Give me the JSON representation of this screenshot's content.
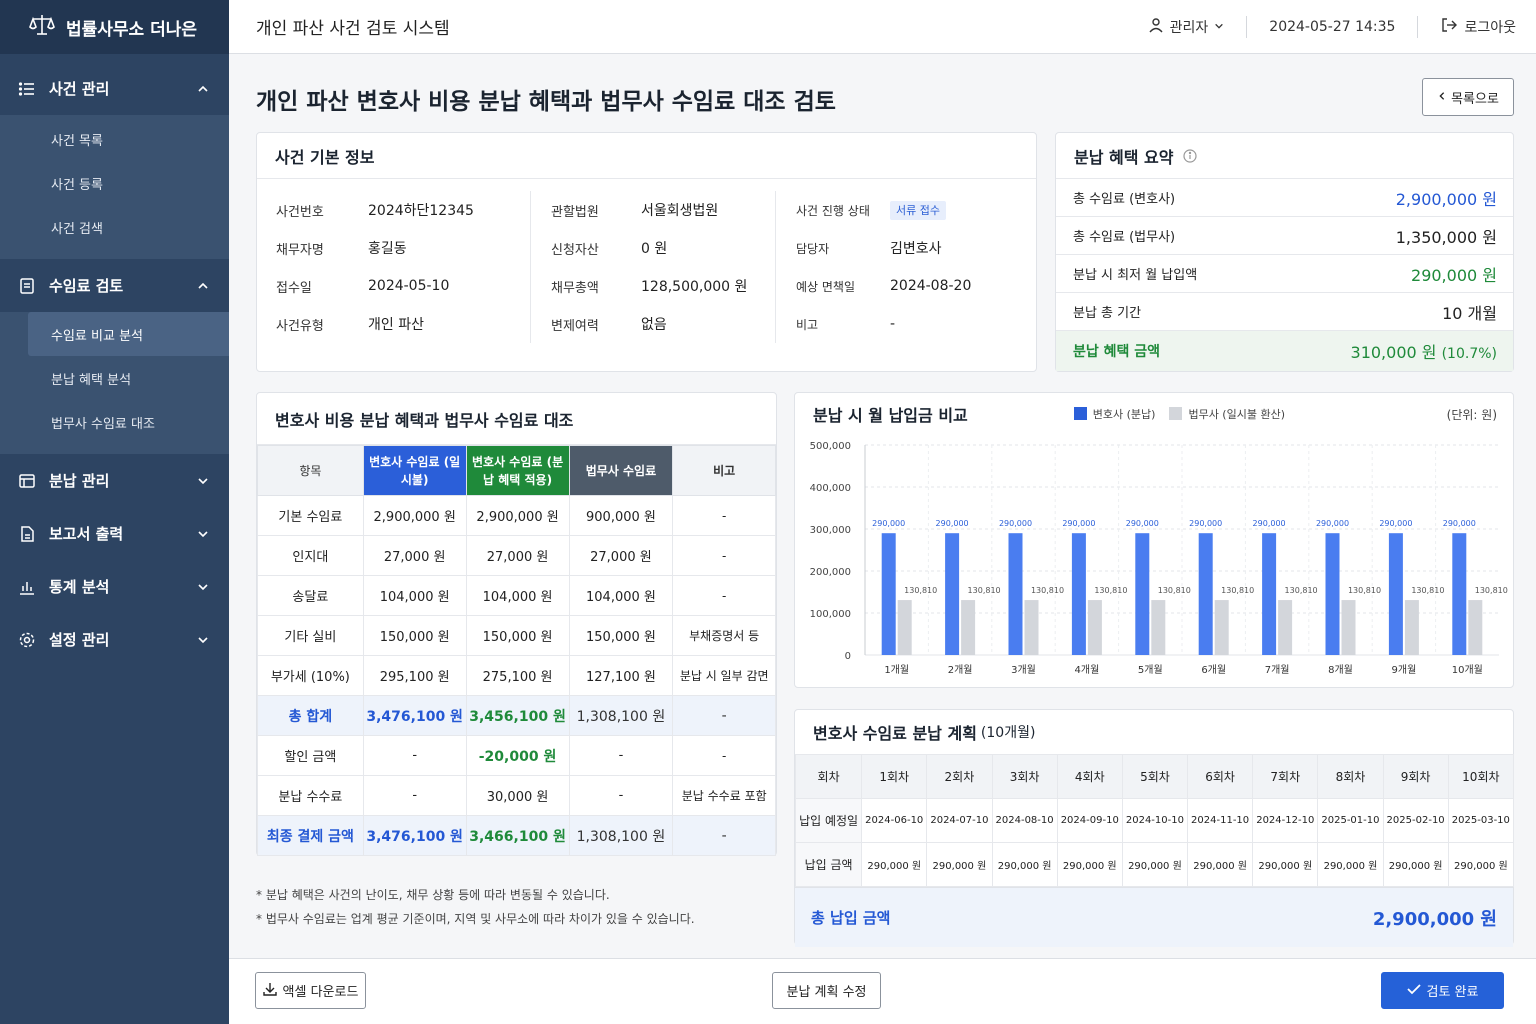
{
  "brand": {
    "name": "법률사무소 더나은"
  },
  "topbar": {
    "system_title": "개인 파산 사건 검토 시스템",
    "user": "관리자",
    "datetime": "2024-05-27 14:35",
    "logout": "로그아웃"
  },
  "sidebar": {
    "case_mgmt": {
      "label": "사건 관리",
      "items": [
        "사건 목록",
        "사건 등록",
        "사건 검색"
      ]
    },
    "fee_review": {
      "label": "수임료 검토",
      "items": [
        "수임료 비교 분석",
        "분납 혜택 분석",
        "법무사 수임료 대조"
      ]
    },
    "installment_mgmt": {
      "label": "분납 관리"
    },
    "report": {
      "label": "보고서 출력"
    },
    "stats": {
      "label": "통계 분석"
    },
    "settings": {
      "label": "설정 관리"
    }
  },
  "page": {
    "title": "개인 파산 변호사 비용 분납 혜택과 법무사 수임료 대조 검토",
    "back": "목록으로"
  },
  "basic_info": {
    "title": "사건 기본 정보",
    "col1": [
      {
        "k": "사건번호",
        "v": "2024하단12345"
      },
      {
        "k": "채무자명",
        "v": "홍길동"
      },
      {
        "k": "접수일",
        "v": "2024-05-10"
      },
      {
        "k": "사건유형",
        "v": "개인 파산"
      }
    ],
    "col2": [
      {
        "k": "관할법원",
        "v": "서울회생법원"
      },
      {
        "k": "신청자산",
        "v": "0 원"
      },
      {
        "k": "채무총액",
        "v": "128,500,000 원"
      },
      {
        "k": "변제여력",
        "v": "없음"
      }
    ],
    "col3": [
      {
        "k": "사건 진행 상태",
        "v": "서류 접수"
      },
      {
        "k": "담당자",
        "v": "김변호사"
      },
      {
        "k": "예상 면책일",
        "v": "2024-08-20"
      },
      {
        "k": "비고",
        "v": "-"
      }
    ]
  },
  "summary": {
    "title": "분납 혜택 요약",
    "rows": [
      {
        "k": "총 수임료 (변호사)",
        "v": "2,900,000 원"
      },
      {
        "k": "총 수임료 (법무사)",
        "v": "1,350,000 원"
      },
      {
        "k": "분납 시 최저 월 납입액",
        "v": "290,000 원"
      },
      {
        "k": "분납 총 기간",
        "v": "10 개월"
      }
    ],
    "benefit": {
      "k": "분납 혜택 금액",
      "v": "310,000 원",
      "pct": "(10.7%)"
    }
  },
  "compare": {
    "title": "변호사 비용 분납 혜택과 법무사 수임료 대조",
    "headers": [
      "항목",
      "변호사 수임료 (일시불)",
      "변호사 수임료 (분납 혜택 적용)",
      "법무사 수임료",
      "비고"
    ],
    "rows": [
      [
        "기본 수임료",
        "2,900,000 원",
        "2,900,000 원",
        "900,000 원",
        "-"
      ],
      [
        "인지대",
        "27,000 원",
        "27,000 원",
        "27,000 원",
        "-"
      ],
      [
        "송달료",
        "104,000 원",
        "104,000 원",
        "104,000 원",
        "-"
      ],
      [
        "기타 실비",
        "150,000 원",
        "150,000 원",
        "150,000 원",
        "부채증명서 등"
      ],
      [
        "부가세 (10%)",
        "295,100 원",
        "275,100 원",
        "127,100 원",
        "분납 시 일부 감면"
      ],
      [
        "총 합계",
        "3,476,100 원",
        "3,456,100 원",
        "1,308,100 원",
        "-"
      ],
      [
        "할인 금액",
        "-",
        "-20,000 원",
        "-",
        "-"
      ],
      [
        "분납 수수료",
        "-",
        "30,000 원",
        "-",
        "분납 수수료 포함"
      ],
      [
        "최종 결제 금액",
        "3,476,100 원",
        "3,466,100 원",
        "1,308,100 원",
        "-"
      ]
    ]
  },
  "notes": [
    "* 분납 혜택은 사건의 난이도, 채무 상황 등에 따라 변동될 수 있습니다.",
    "* 법무사 수임료는 업계 평균 기준이며, 지역 및 사무소에 따라 차이가 있을 수 있습니다."
  ],
  "chart": {
    "title": "분납 시 월 납입금 비교",
    "unit": "(단위: 원)",
    "legend": [
      "변호사 (분납)",
      "법무사 (일시불 환산)"
    ]
  },
  "chart_data": {
    "type": "bar",
    "categories": [
      "1개월",
      "2개월",
      "3개월",
      "4개월",
      "5개월",
      "6개월",
      "7개월",
      "8개월",
      "9개월",
      "10개월"
    ],
    "series": [
      {
        "name": "변호사 (분납)",
        "values": [
          290000,
          290000,
          290000,
          290000,
          290000,
          290000,
          290000,
          290000,
          290000,
          290000
        ],
        "color": "#4a7df0"
      },
      {
        "name": "법무사 (일시불 환산)",
        "values": [
          130810,
          130810,
          130810,
          130810,
          130810,
          130810,
          130810,
          130810,
          130810,
          130810
        ],
        "color": "#d3d6db"
      }
    ],
    "data_labels": [
      [
        "290,000",
        "130,810"
      ]
    ],
    "yticks": [
      "500,000",
      "400,000",
      "300,000",
      "200,000",
      "100,000",
      "0"
    ],
    "ylim": [
      0,
      500000
    ],
    "grid": true,
    "legend": "top"
  },
  "plan": {
    "title": "변호사 수임료 분납 계획",
    "subtitle": "(10개월)",
    "headers": [
      "회차",
      "1회차",
      "2회차",
      "3회차",
      "4회차",
      "5회차",
      "6회차",
      "7회차",
      "8회차",
      "9회차",
      "10회차"
    ],
    "dates_label": "납입 예정일",
    "dates": [
      "2024-06-10",
      "2024-07-10",
      "2024-08-10",
      "2024-09-10",
      "2024-10-10",
      "2024-11-10",
      "2024-12-10",
      "2025-01-10",
      "2025-02-10",
      "2025-03-10"
    ],
    "amount_label": "납입 금액",
    "amounts": [
      "290,000 원",
      "290,000 원",
      "290,000 원",
      "290,000 원",
      "290,000 원",
      "290,000 원",
      "290,000 원",
      "290,000 원",
      "290,000 원",
      "290,000 원"
    ],
    "total_label": "총 납입 금액",
    "total": "2,900,000 원"
  },
  "footer": {
    "excel": "액셀 다운로드",
    "edit": "분납 계획 수정",
    "complete": "검토 완료"
  }
}
